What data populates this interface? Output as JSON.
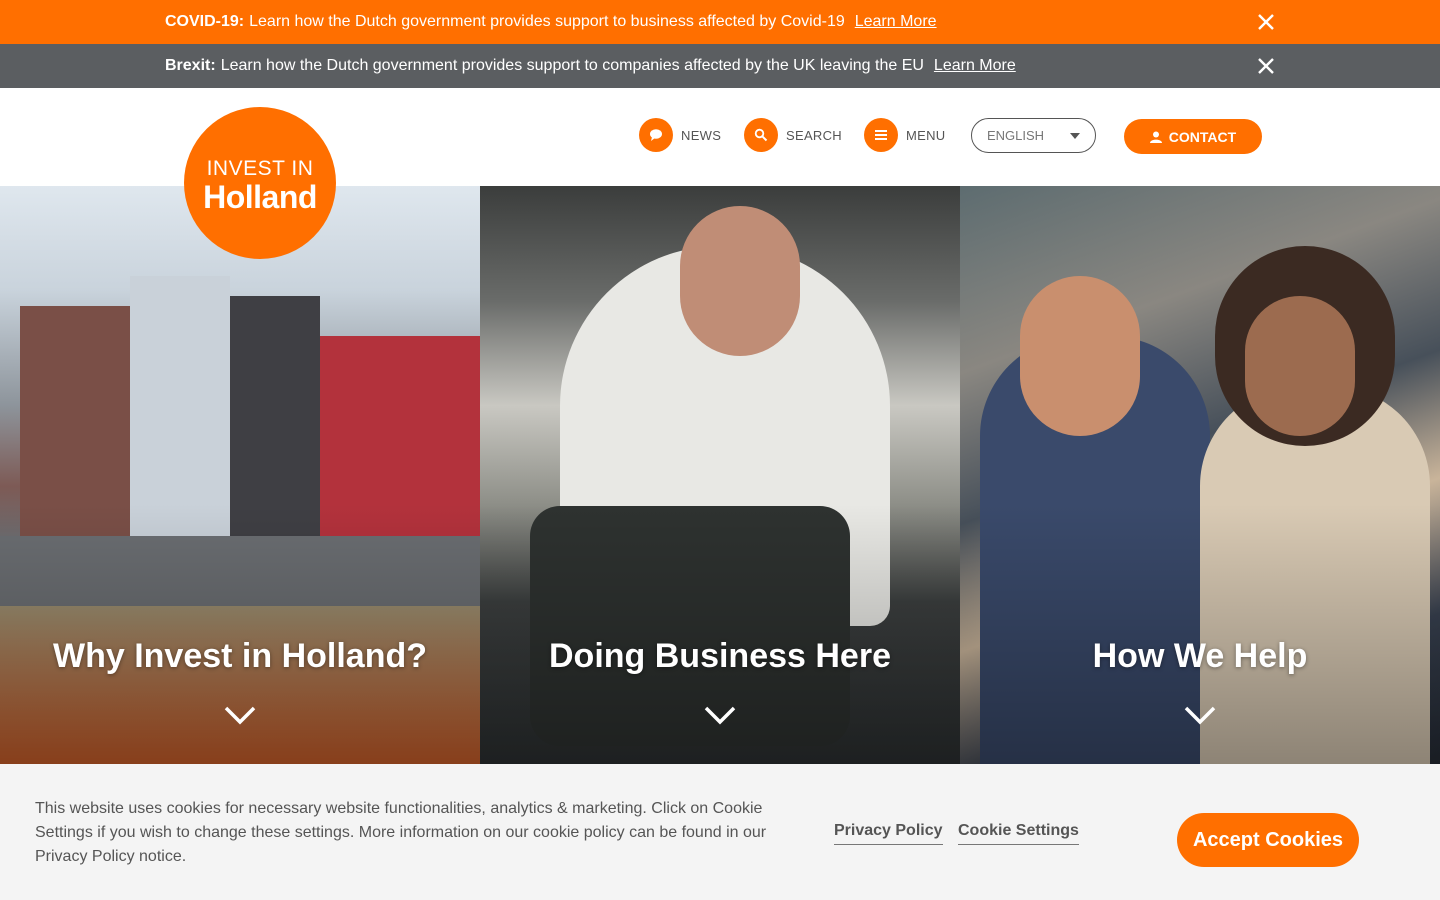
{
  "banners": {
    "covid": {
      "label": "COVID-19:",
      "text": "Learn how the Dutch government provides support to business affected by Covid-19",
      "link": "Learn More"
    },
    "brexit": {
      "label": "Brexit:",
      "text": "Learn how the Dutch government provides support to companies affected by the UK leaving the EU",
      "link": "Learn More"
    }
  },
  "logo": {
    "line1": "INVEST IN",
    "line2": "Holland"
  },
  "nav": {
    "news": "NEWS",
    "search": "SEARCH",
    "menu": "MENU",
    "language": "ENGLISH",
    "contact": "CONTACT"
  },
  "panels": [
    {
      "title": "Why Invest in Holland?"
    },
    {
      "title": "Doing Business Here"
    },
    {
      "title": "How We Help"
    }
  ],
  "cookie": {
    "text": "This website uses cookies for necessary website functionalities, analytics & marketing. Click on Cookie Settings if you wish to change these settings. More information on our cookie policy can be found in our Privacy Policy notice.",
    "privacy": "Privacy Policy",
    "settings": "Cookie Settings",
    "accept": "Accept Cookies"
  },
  "colors": {
    "brand_orange": "#ff6f00",
    "banner_gray": "#5b5e61",
    "cookie_bg": "#f4f4f4"
  }
}
